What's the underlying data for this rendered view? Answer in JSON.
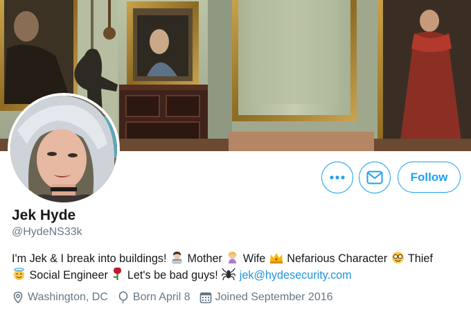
{
  "profile": {
    "display_name": "Jek Hyde",
    "handle": "@HydeNS33k",
    "bio": {
      "p1": "I'm Jek & I break into buildings!",
      "p2": "Mother",
      "p3": "Wife",
      "p4": "Nefarious Character",
      "p5": "Thief",
      "p6": "Social Engineer",
      "p7": "Let's be bad guys!",
      "email": "jek@hydesecurity.com"
    },
    "location": "Washington, DC",
    "birthday": "Born April 8",
    "joined": "Joined September 2016"
  },
  "actions": {
    "follow_label": "Follow",
    "more_icon": "more-icon",
    "message_icon": "envelope-icon"
  },
  "colors": {
    "accent": "#1da1f2",
    "secondary_text": "#657786",
    "primary_text": "#14171a"
  }
}
